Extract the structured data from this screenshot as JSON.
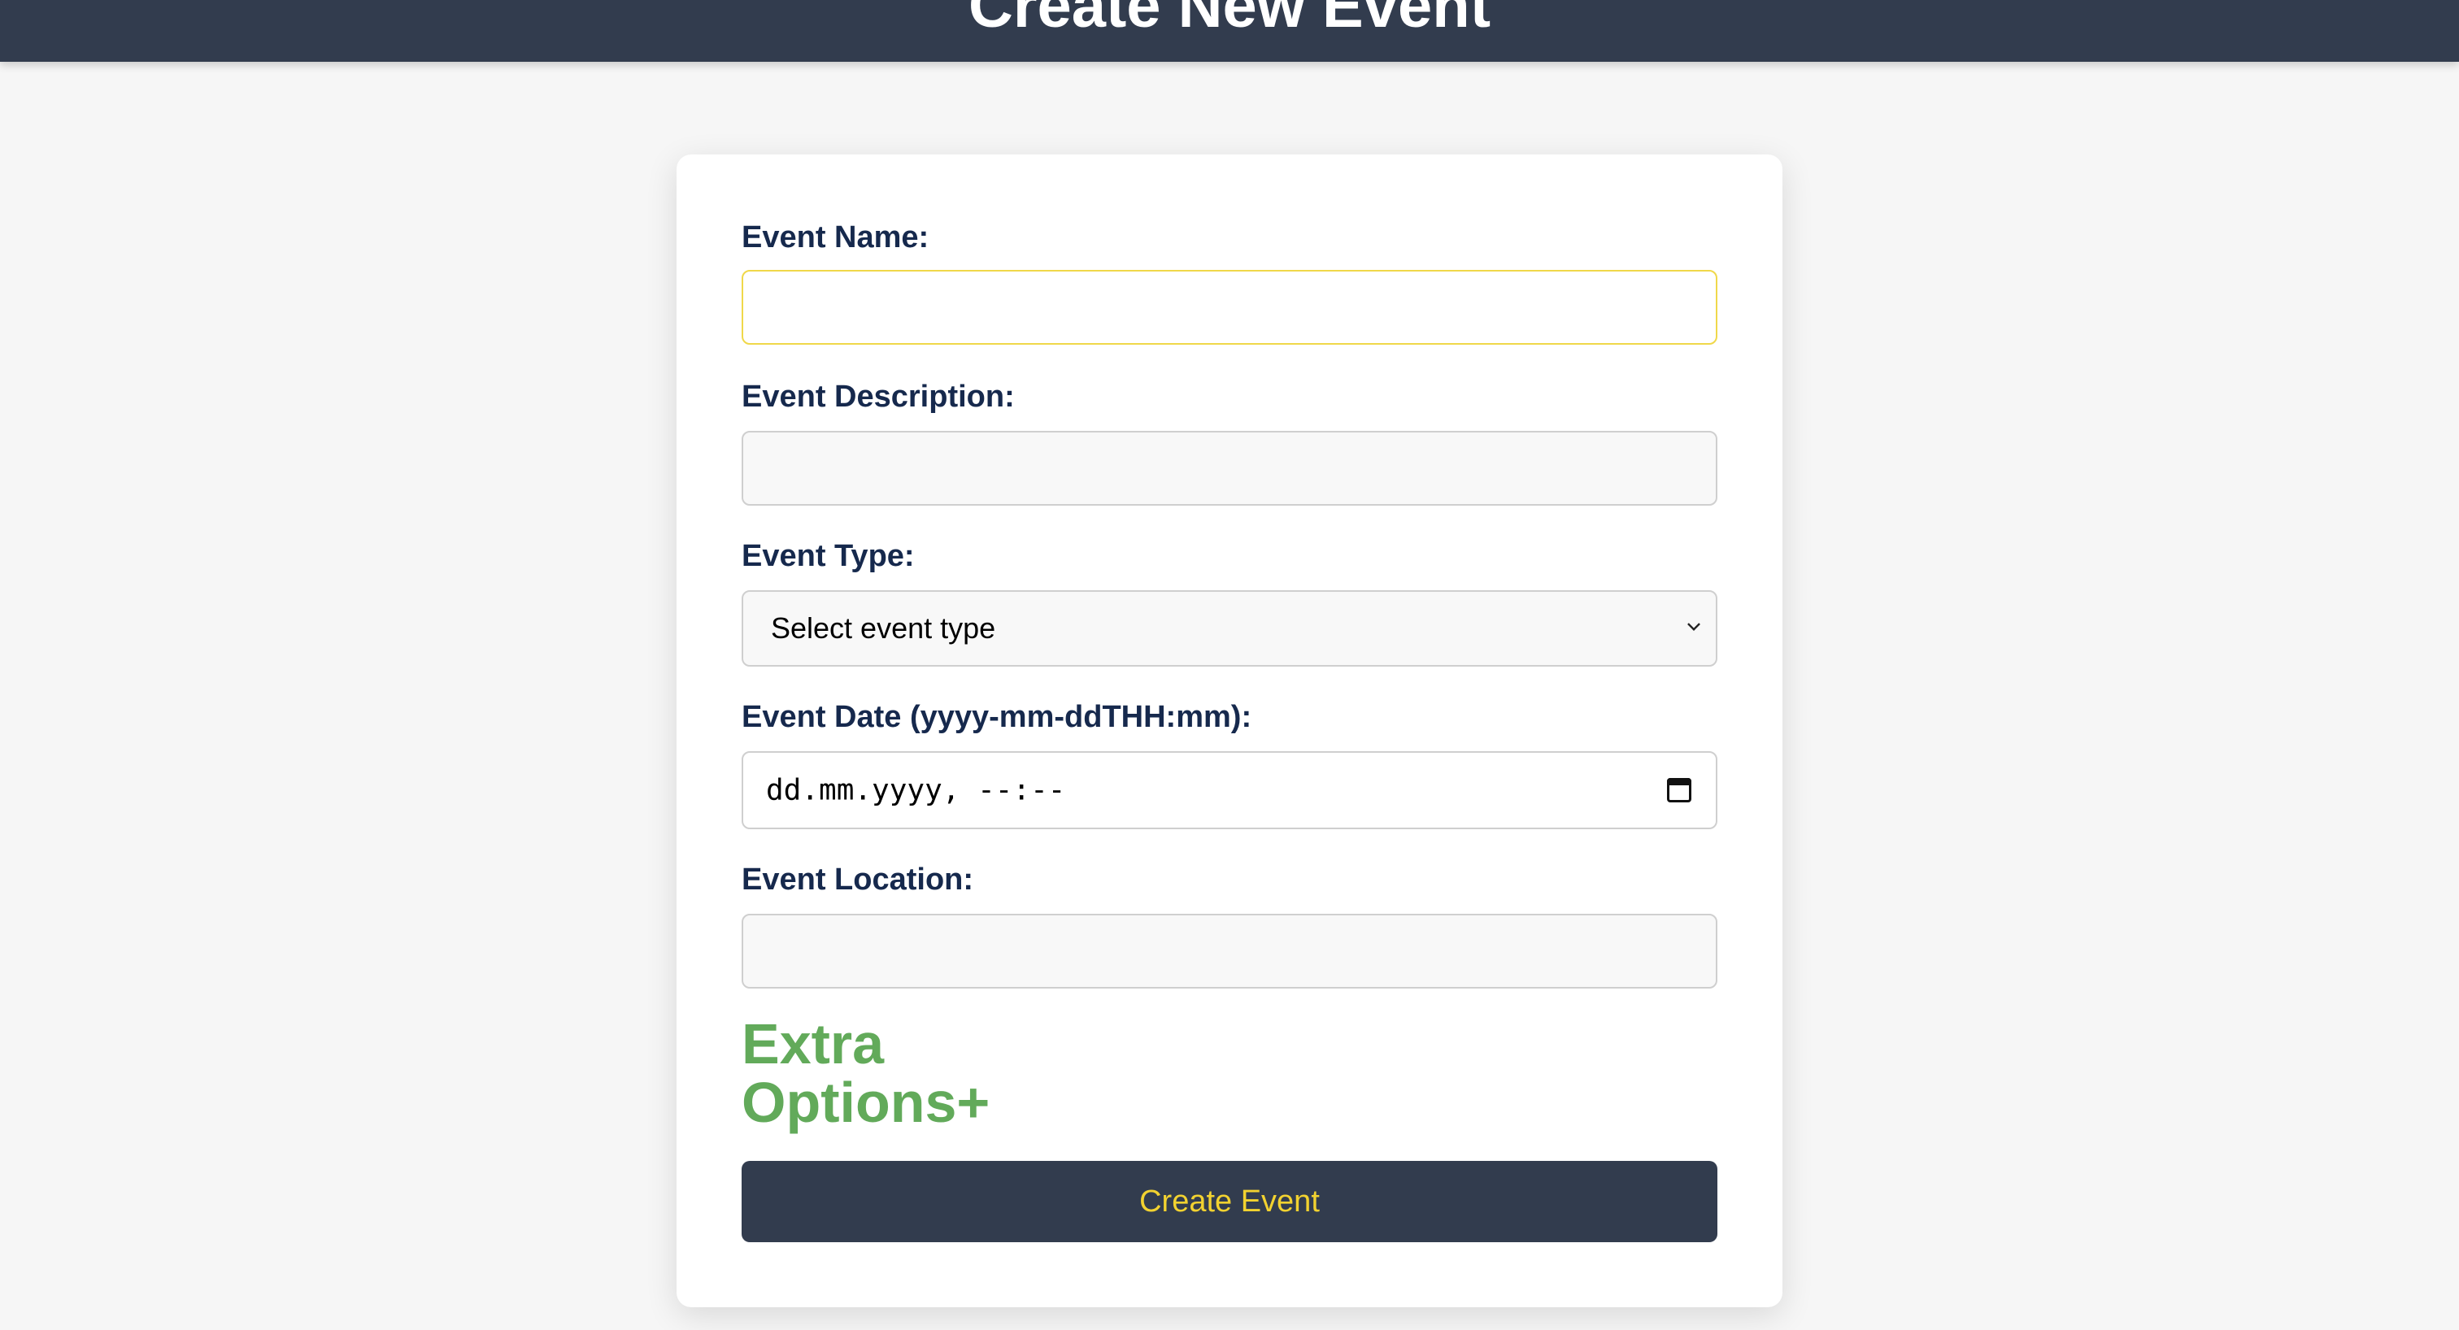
{
  "header": {
    "title": "Create New Event"
  },
  "form": {
    "event_name": {
      "label": "Event Name:",
      "value": "",
      "placeholder": ""
    },
    "event_description": {
      "label": "Event Description:",
      "value": "",
      "placeholder": ""
    },
    "event_type": {
      "label": "Event Type:",
      "selected": "Select event type"
    },
    "event_date": {
      "label": "Event Date (yyyy-mm-ddTHH:mm):",
      "display_value": "dd.mm.yyyy, --:--"
    },
    "event_location": {
      "label": "Event Location:",
      "value": "",
      "placeholder": ""
    },
    "extra_options_label": "Extra Options+",
    "submit_label": "Create Event"
  },
  "icons": {
    "type_dropdown": "chevron-down-icon",
    "date_picker": "calendar-icon"
  },
  "colors": {
    "header_bg": "#323c4e",
    "label_text": "#16294d",
    "extra_options": "#62aa5a",
    "button_text": "#f2d230",
    "focus_border": "#f0d84a"
  }
}
